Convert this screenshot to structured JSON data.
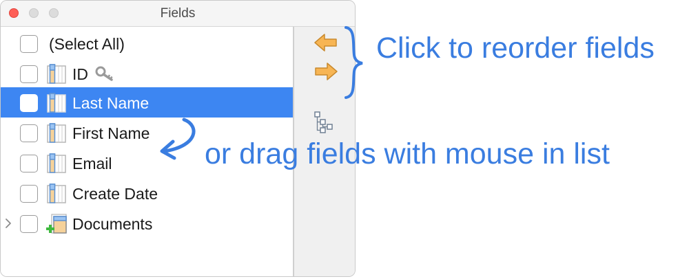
{
  "window": {
    "title": "Fields"
  },
  "fields": [
    {
      "label": "(Select All)",
      "icon": "none",
      "selected": false,
      "expandable": false
    },
    {
      "label": "ID",
      "icon": "table-field-icon",
      "key": true,
      "selected": false,
      "expandable": false
    },
    {
      "label": "Last Name",
      "icon": "table-field-icon",
      "selected": true,
      "expandable": false
    },
    {
      "label": "First Name",
      "icon": "table-field-icon",
      "selected": false,
      "expandable": false
    },
    {
      "label": "Email",
      "icon": "table-field-icon",
      "selected": false,
      "expandable": false
    },
    {
      "label": "Create Date",
      "icon": "table-field-icon",
      "selected": false,
      "expandable": false
    },
    {
      "label": "Documents",
      "icon": "add-table-icon",
      "selected": false,
      "expandable": true
    }
  ],
  "side_panel": {
    "buttons": [
      "move-up-arrow-icon",
      "move-down-arrow-icon",
      "hierarchy-icon"
    ]
  },
  "annotations": {
    "reorder": "Click to reorder fields",
    "drag": "or drag fields with mouse in list"
  },
  "colors": {
    "selection": "#3d86f2",
    "annotation": "#3a7de0",
    "arrow_fill": "#f7b554",
    "close_button": "#fe5f57"
  }
}
